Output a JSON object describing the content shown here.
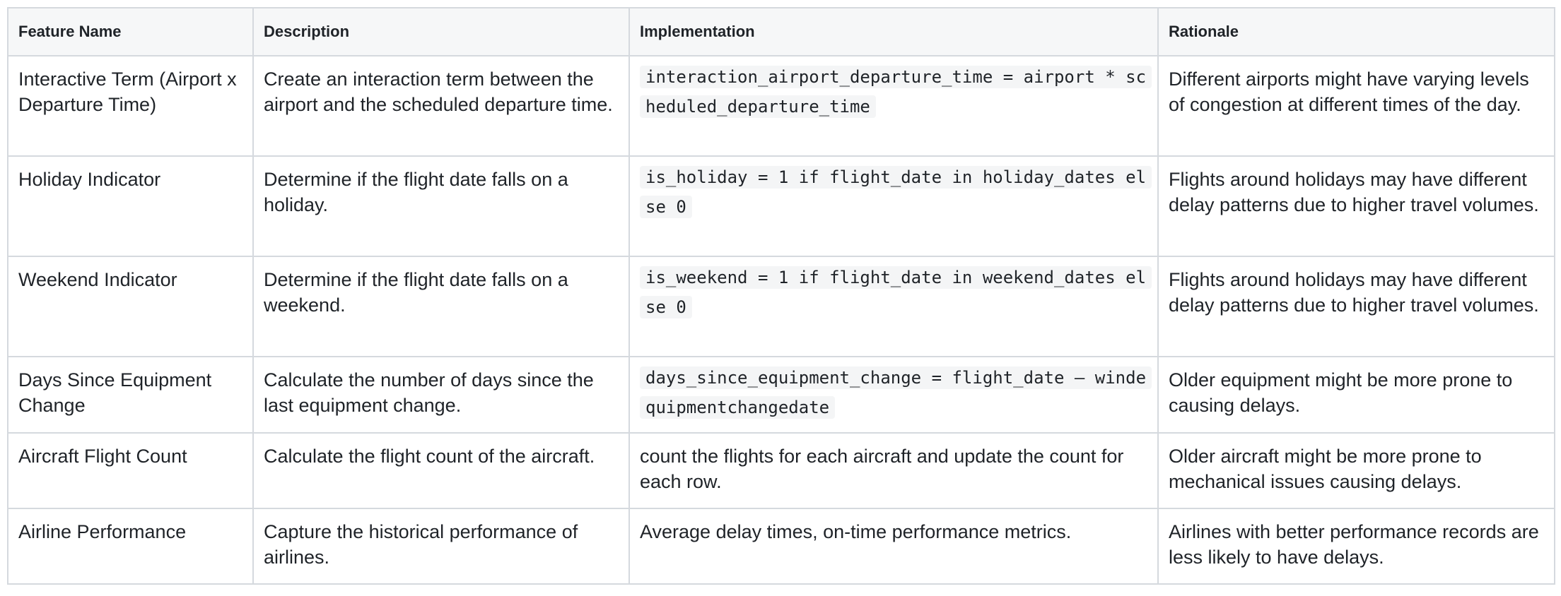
{
  "table": {
    "headers": [
      "Feature Name",
      "Description",
      "Implementation",
      "Rationale"
    ],
    "rows": [
      {
        "feature": "Interactive Term (Airport x Departure Time)",
        "description": "Create an interaction term between the airport and the scheduled departure time.",
        "implementation": "interaction_airport_departure_time = airport * scheduled_departure_time",
        "rationale": "Different airports might have varying levels of congestion at different times of the day."
      },
      {
        "feature": "Holiday Indicator",
        "description": "Determine if the flight date falls on a holiday.",
        "implementation": "is_holiday = 1 if flight_date in holiday_dates else 0",
        "rationale": "Flights around holidays may have different delay patterns due to higher travel volumes."
      },
      {
        "feature": "Weekend Indicator",
        "description": "Determine if the flight date falls on a weekend.",
        "implementation": "is_weekend = 1 if flight_date in weekend_dates else 0",
        "rationale": "Flights around holidays may have different delay patterns due to higher travel volumes."
      },
      {
        "feature": "Days Since Equipment Change",
        "description": "Calculate the number of days since the last equipment change.",
        "implementation": "days_since_equipment_change = flight_date – windequipmentchangedate",
        "rationale": "Older equipment might be more prone to causing delays."
      },
      {
        "feature": "Aircraft Flight Count",
        "description": "Calculate the flight count of the aircraft.",
        "implementation": "count the flights for each aircraft and update the count for each row.",
        "rationale": "Older aircraft might be more prone to mechanical issues causing delays."
      },
      {
        "feature": "Airline Performance",
        "description": "Capture the historical performance of airlines.",
        "implementation": "Average delay times, on-time performance metrics.",
        "rationale": "Airlines with better performance records are less likely to have delays."
      }
    ]
  }
}
